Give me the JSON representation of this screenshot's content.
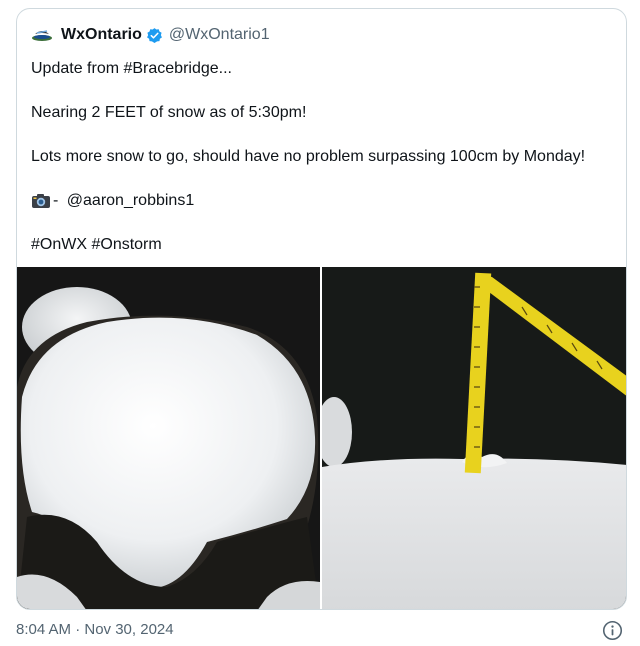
{
  "author": {
    "display_name": "WxOntario",
    "handle": "@WxOntario1",
    "logo_icon": "storm-logo-icon",
    "verified_icon": "verified-badge-icon"
  },
  "tweet": {
    "line1": "Update from #Bracebridge...",
    "line2": "Nearing 2 FEET of snow as of 5:30pm!",
    "line3": "Lots more snow to go, should have no problem surpassing 100cm by Monday!",
    "credit_separator": "- ",
    "credit_handle": "@aaron_robbins1",
    "hashtag1": "#OnWX",
    "hashtag2": "#Onstorm"
  },
  "media": {
    "photo1": "snow-pile-photo",
    "photo2": "snow-measuring-tape-photo"
  },
  "footer": {
    "timestamp": "8:04 AM · Nov 30, 2024",
    "info_icon": "info-icon"
  },
  "colors": {
    "text": "#0f1419",
    "secondary": "#536471",
    "border": "#cfd9de",
    "verified": "#1d9bf0",
    "tape": "#e8d21e"
  }
}
